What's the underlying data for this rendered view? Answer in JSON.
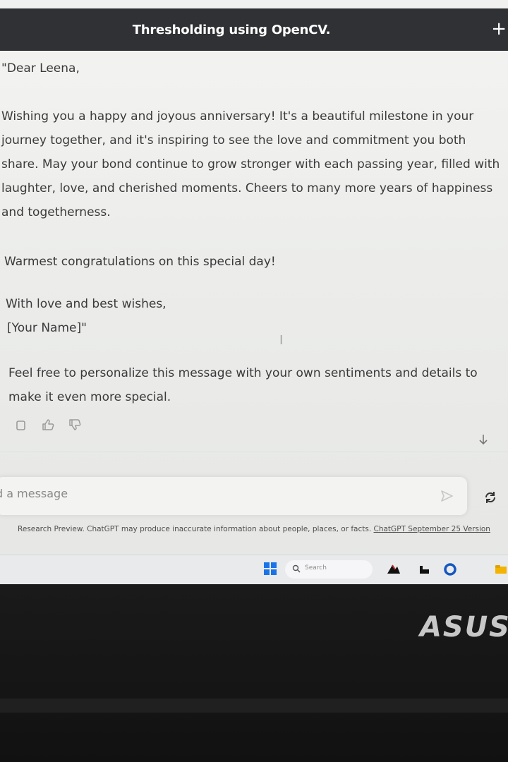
{
  "header": {
    "title": "Thresholding using OpenCV.",
    "new_chat_glyph": "+"
  },
  "message": {
    "greeting": "\"Dear Leena,",
    "body": "Wishing you a happy and joyous anniversary! It's a beautiful milestone in your journey together, and it's inspiring to see the love and commitment you both share. May your bond continue to grow stronger with each passing year, filled with laughter, love, and cherished moments. Cheers to many more years of happiness and togetherness.",
    "congrats": "Warmest congratulations on this special day!",
    "signoff": "With love and best wishes,",
    "name": "[Your Name]\"",
    "note": "Feel free to personalize this message with your own sentiments and details to make it even more special."
  },
  "composer": {
    "placeholder": "d a message"
  },
  "footer": {
    "disclaimer": "Research Preview. ChatGPT may produce inaccurate information about people, places, or facts.",
    "version_link": "ChatGPT September 25 Version"
  },
  "taskbar": {
    "search_label": "Search"
  },
  "bezel": {
    "brand": "ASUS"
  },
  "colors": {
    "title_bar": "#2f3134",
    "text": "#3a3a3a",
    "taskbar": "#e9eaec",
    "bezel": "#151515"
  },
  "icons": [
    "plus-icon",
    "copy-icon",
    "thumbs-up-icon",
    "thumbs-down-icon",
    "arrow-down-icon",
    "send-icon",
    "regenerate-icon",
    "windows-logo-icon",
    "search-icon",
    "app-icon",
    "file-explorer-icon",
    "edge-icon",
    "folder-icon"
  ]
}
